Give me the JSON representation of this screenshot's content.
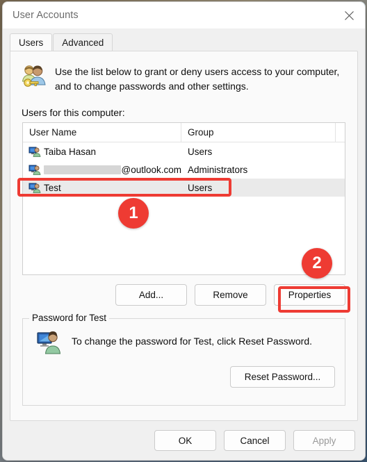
{
  "window": {
    "title": "User Accounts",
    "close_icon": "close-icon"
  },
  "tabs": [
    {
      "label": "Users",
      "active": true
    },
    {
      "label": "Advanced",
      "active": false
    }
  ],
  "intro": {
    "icon": "users-key-icon",
    "text": "Use the list below to grant or deny users access to your computer, and to change passwords and other settings."
  },
  "list": {
    "label": "Users for this computer:",
    "columns": [
      "User Name",
      "Group",
      ""
    ],
    "rows": [
      {
        "icon": "user-account-icon",
        "name": "Taiba Hasan",
        "name_redacted": false,
        "group": "Users",
        "selected": false
      },
      {
        "icon": "user-account-icon",
        "name": "@outlook.com",
        "name_redacted": true,
        "group": "Administrators",
        "selected": false
      },
      {
        "icon": "user-account-icon",
        "name": "Test",
        "name_redacted": false,
        "group": "Users",
        "selected": true
      }
    ]
  },
  "list_buttons": {
    "add": "Add...",
    "remove": "Remove",
    "properties": "Properties"
  },
  "password_group": {
    "legend": "Password for Test",
    "icon": "user-monitor-icon",
    "text": "To change the password for Test, click Reset Password.",
    "reset_button": "Reset Password..."
  },
  "footer": {
    "ok": "OK",
    "cancel": "Cancel",
    "apply": "Apply",
    "apply_enabled": false
  },
  "annotations": {
    "badge_one": "1",
    "badge_two": "2",
    "accent_color": "#ee3b33"
  }
}
